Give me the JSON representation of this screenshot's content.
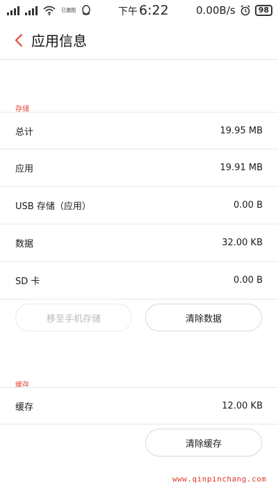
{
  "status_bar": {
    "hd_label": "已激图",
    "ampm": "下午",
    "time": "6:22",
    "net_speed": "0.00B/s",
    "battery": "98"
  },
  "header": {
    "title": "应用信息"
  },
  "storage": {
    "section_label": "存储",
    "rows": [
      {
        "label": "总计",
        "value": "19.95 MB"
      },
      {
        "label": "应用",
        "value": "19.91 MB"
      },
      {
        "label": "USB 存储（应用）",
        "value": "0.00 B"
      },
      {
        "label": "数据",
        "value": "32.00 KB"
      },
      {
        "label": "SD 卡",
        "value": "0.00 B"
      }
    ],
    "move_button": "移至手机存储",
    "clear_data_button": "清除数据"
  },
  "cache": {
    "section_label": "缓存",
    "rows": [
      {
        "label": "缓存",
        "value": "12.00 KB"
      }
    ],
    "clear_cache_button": "清除缓存"
  },
  "watermark": "www.qinpinchang.com",
  "colors": {
    "accent": "#e0463c",
    "divider": "#e6e6e6"
  }
}
